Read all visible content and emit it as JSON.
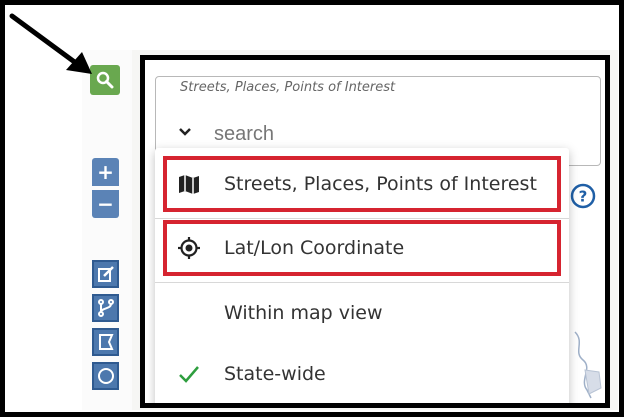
{
  "search": {
    "legend": "Streets, Places, Points of Interest",
    "placeholder": "search",
    "chevron_icon": "chevron-down-icon"
  },
  "menu": {
    "items": [
      {
        "label": "Streets, Places, Points of Interest",
        "icon": "map-icon",
        "highlighted": true
      },
      {
        "label": "Lat/Lon Coordinate",
        "icon": "crosshair-icon",
        "highlighted": true
      },
      {
        "label": "Within map view",
        "icon": "",
        "highlighted": false
      },
      {
        "label": "State-wide",
        "icon": "checkmark-icon",
        "checked": true,
        "highlighted": false
      }
    ]
  },
  "toolbar": {
    "search_icon": "search-icon",
    "zoom_in": "+",
    "zoom_out": "−",
    "tools": [
      "edit-icon",
      "branch-icon",
      "polygon-icon",
      "circle-icon"
    ]
  },
  "help_icon": "help-icon",
  "colors": {
    "search_button": "#69a84f",
    "zoom_button": "#5b83b6",
    "highlight_border": "#d62430",
    "check": "#2e9e3e"
  }
}
